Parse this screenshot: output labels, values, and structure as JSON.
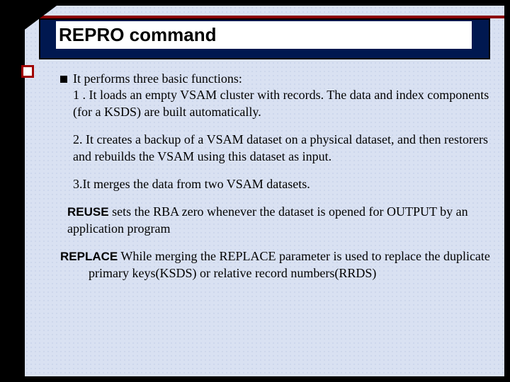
{
  "title": "REPRO  command",
  "bullet_intro": "It performs three basic functions:",
  "point1": "1 . It loads an empty VSAM cluster with records. The data  and index components (for a KSDS) are built automatically.",
  "point2": "2. It creates a backup of a VSAM dataset on a physical  dataset, and then restorers and rebuilds the VSAM using this dataset as input.",
  "point3": "3.It merges the data from two VSAM datasets.",
  "reuse_label": "REUSE",
  "reuse_text": " sets the RBA zero whenever the dataset is opened for OUTPUT by an application program",
  "replace_label": "REPLACE",
  "replace_text": "   While merging the REPLACE parameter is used to replace the  duplicate primary keys(KSDS) or relative record numbers(RRDS)"
}
